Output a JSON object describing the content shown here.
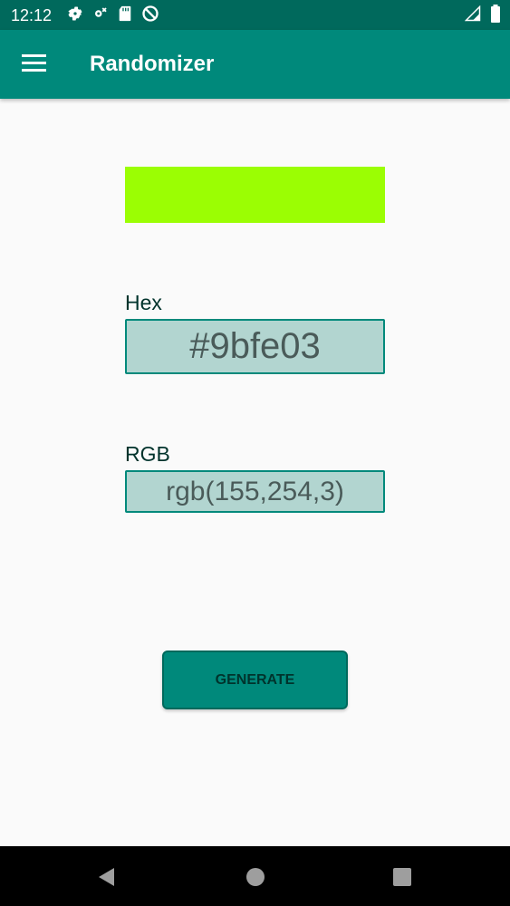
{
  "status_bar": {
    "time": "12:12",
    "left_icons": [
      "settings-icon",
      "settings-sync-icon",
      "sd-card-icon",
      "no-sim-icon"
    ],
    "right_icons": [
      "signal-icon",
      "battery-icon"
    ]
  },
  "app_bar": {
    "title": "Randomizer",
    "menu_icon": "menu-icon"
  },
  "color": {
    "swatch_color": "#9bfe03"
  },
  "hex": {
    "label": "Hex",
    "value": "#9bfe03"
  },
  "rgb": {
    "label": "RGB",
    "value": "rgb(155,254,3)"
  },
  "actions": {
    "generate_label": "GENERATE"
  },
  "theme": {
    "primary": "#00897b",
    "primary_dark": "#00695c",
    "field_background": "#b2d5d0"
  },
  "nav_bar": {
    "buttons": [
      "back-icon",
      "home-icon",
      "recents-icon"
    ]
  }
}
